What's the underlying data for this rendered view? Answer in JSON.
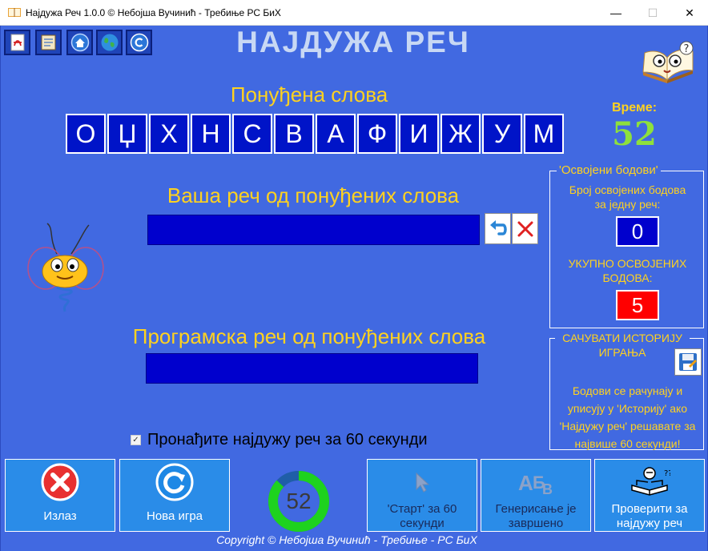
{
  "window": {
    "title": "Најдужа Реч 1.0.0   ©   Небојша Вучинић - Требиње РС БиХ",
    "minimize": "—",
    "maximize": "☐",
    "close": "✕"
  },
  "toolbar": {
    "icons": [
      "pdf-icon",
      "notes-icon",
      "home-icon",
      "globe-icon",
      "copyright-icon"
    ]
  },
  "app_title": "НАЈДУЖА РЕЧ",
  "offered_letters": {
    "label": "Понуђена слова",
    "letters": [
      "О",
      "Џ",
      "Х",
      "Н",
      "С",
      "В",
      "А",
      "Ф",
      "И",
      "Ж",
      "У",
      "М"
    ]
  },
  "timer": {
    "label": "Време:",
    "value": "52"
  },
  "your_word": {
    "label": "Ваша реч од понуђених слова",
    "value": ""
  },
  "program_word": {
    "label": "Програмска реч од понуђених слова",
    "value": ""
  },
  "points": {
    "legend": "'Освојени бодови'",
    "per_word_label": "Број освојених бодова за једну реч:",
    "per_word_value": "0",
    "total_label": "УКУПНО ОСВОЈЕНИХ БОДОВА:",
    "total_value": "5"
  },
  "history": {
    "legend": "САЧУВАТИ ИСТОРИЈУ ИГРАЊА",
    "note": "Бодови се рачунају и уписују у 'Историју' ако 'Најдужу реч' решавате за највише 60 секунди!"
  },
  "checkbox": {
    "label": "Пронађите најдужу реч за 60 секунди",
    "checked": true
  },
  "buttons": {
    "exit": "Излаз",
    "new_game": "Нова игра",
    "start": "'Старт' за 60 секунди",
    "generate": "Генерисање је завршено",
    "check": "Проверити за најдужу реч"
  },
  "countdown": {
    "value": "52",
    "fraction": 0.87
  },
  "copyright": "Copyright © Небојша Вучинић - Требиње - РС БиХ",
  "colors": {
    "background": "#4169e1",
    "accent_yellow": "#ffd21f",
    "field_blue": "#0000cd",
    "total_box": "#ff0000",
    "timer_green": "#8ee03c"
  }
}
